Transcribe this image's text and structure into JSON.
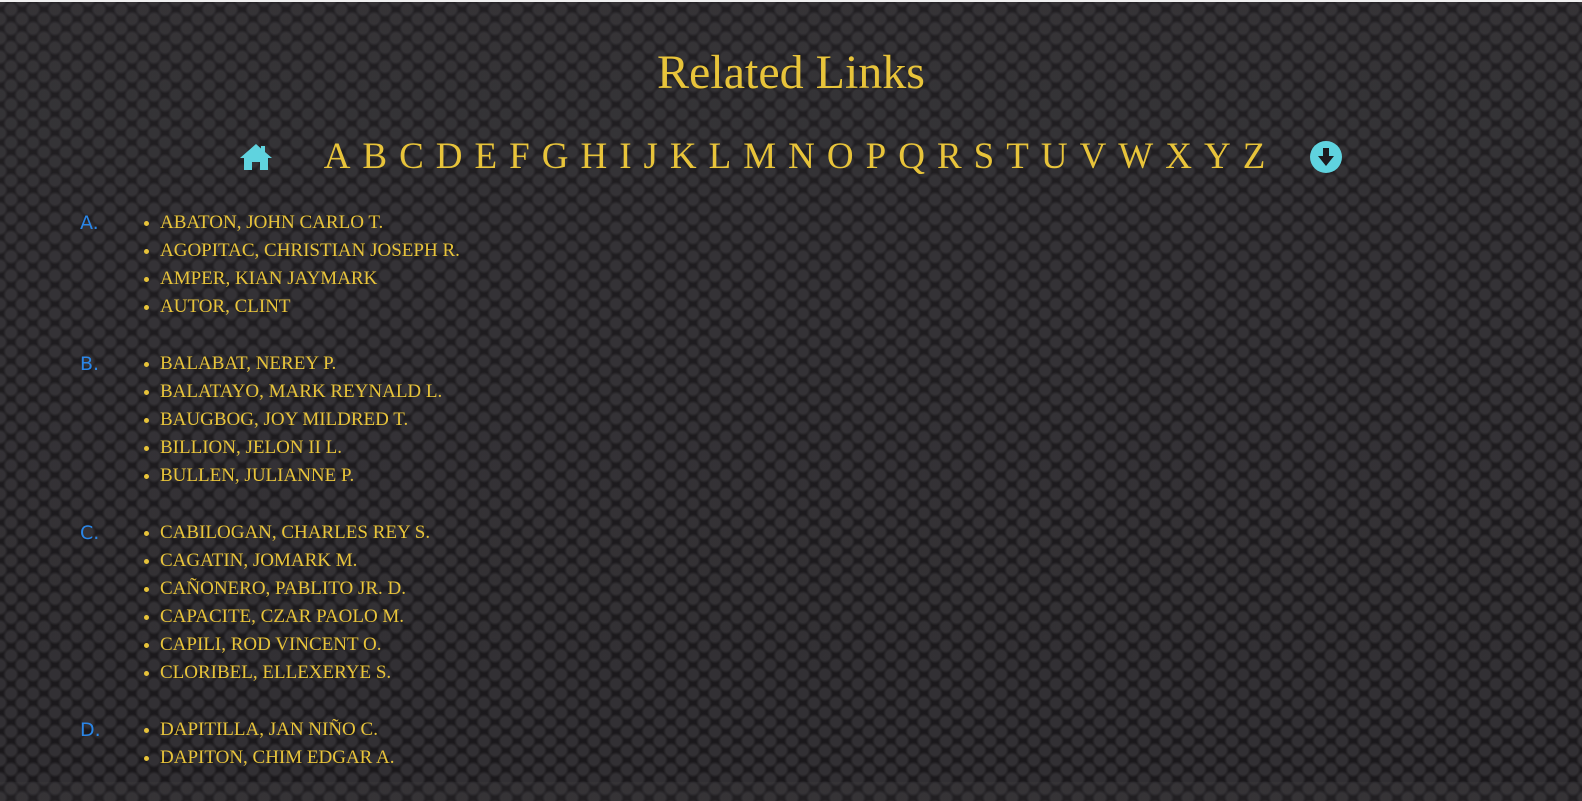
{
  "page": {
    "title": "Related Links"
  },
  "nav": {
    "home_icon": "home-icon",
    "down_icon": "arrow-circle-down-icon",
    "icon_color": "#5fd3df",
    "letters": [
      "A",
      "B",
      "C",
      "D",
      "E",
      "F",
      "G",
      "H",
      "I",
      "J",
      "K",
      "L",
      "M",
      "N",
      "O",
      "P",
      "Q",
      "R",
      "S",
      "T",
      "U",
      "V",
      "W",
      "X",
      "Y",
      "Z"
    ]
  },
  "colors": {
    "accent": "#e8c43a",
    "section_label": "#2a86e8"
  },
  "sections": [
    {
      "label": "A.",
      "names": [
        "ABATON, JOHN CARLO T.",
        "AGOPITAC, CHRISTIAN JOSEPH R.",
        "AMPER, KIAN JAYMARK",
        "AUTOR, CLINT"
      ]
    },
    {
      "label": "B.",
      "names": [
        "BALABAT, NEREY P.",
        "BALATAYO, MARK REYNALD L.",
        "BAUGBOG, JOY MILDRED T.",
        "BILLION, JELON II L.",
        "BULLEN, JULIANNE P."
      ]
    },
    {
      "label": "C.",
      "names": [
        "CABILOGAN, CHARLES REY S.",
        "CAGATIN, JOMARK M.",
        "CAÑONERO, PABLITO JR. D.",
        "CAPACITE, CZAR PAOLO M.",
        "CAPILI, ROD VINCENT O.",
        "CLORIBEL, ELLEXERYE S."
      ]
    },
    {
      "label": "D.",
      "names": [
        "DAPITILLA, JAN NIÑO C.",
        "DAPITON, CHIM EDGAR A."
      ]
    }
  ]
}
